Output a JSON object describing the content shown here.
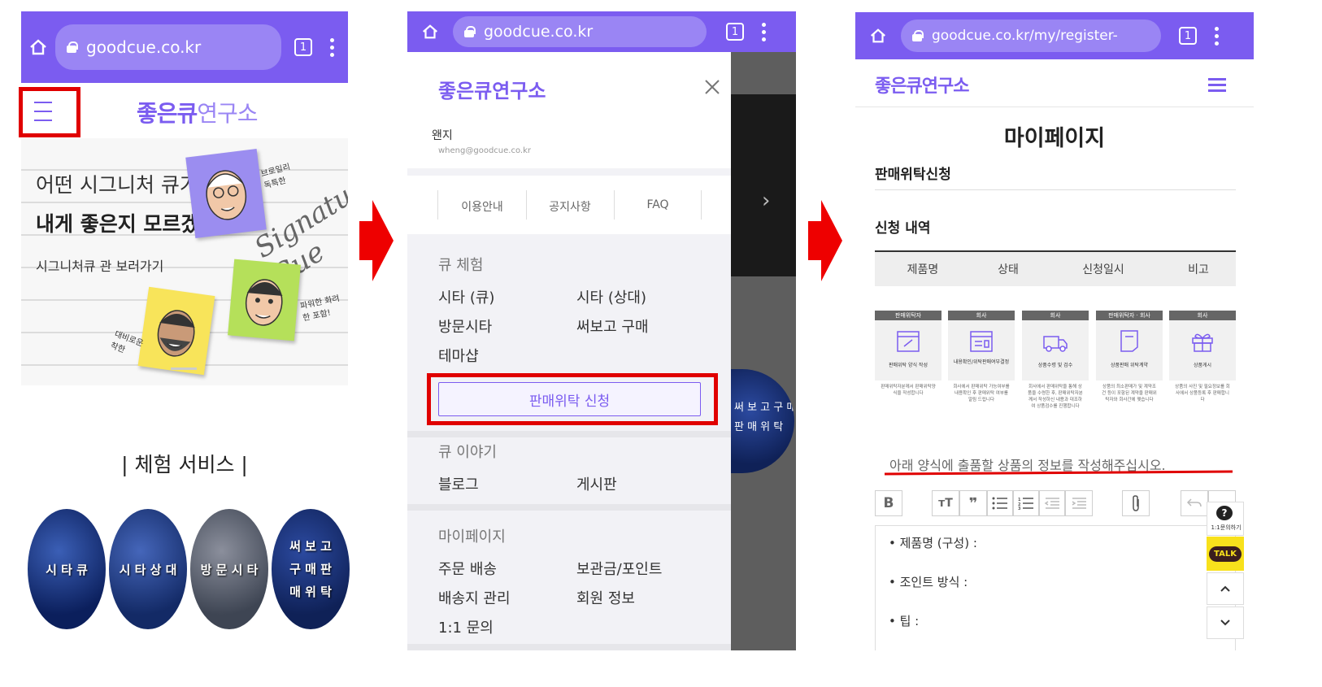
{
  "panel1": {
    "url": "goodcue.co.kr",
    "tab_count": "1",
    "logo_bold": "좋은큐",
    "logo_light": "연구소",
    "banner_line1": "어떤 시그니처 큐가",
    "banner_line2": "내게 좋은지 모르겠다면?",
    "banner_line3": "시그니처큐 관 보러가기",
    "banner_sign": "Signature Cue",
    "banner_note1": "브로일리 독특한",
    "banner_note2": "파워한 화려한 포함!",
    "banner_note3": "대비로운 착한",
    "section_title": "| 체험 서비스 |",
    "circles": [
      "시 타 큐",
      "시 타 상 대",
      "방 문 시 타",
      "써 보 고 구 매 판 매 위 탁"
    ]
  },
  "panel2": {
    "url": "goodcue.co.kr",
    "tab_count": "1",
    "logo": "좋은큐연구소",
    "user_name": "왠지",
    "user_email": "wheng@goodcue.co.kr",
    "quick_tabs": [
      "이용안내",
      "공지사항",
      "FAQ"
    ],
    "section1_title": "큐 체험",
    "section1_items": [
      "시타 (큐)",
      "시타 (상대)",
      "방문시타",
      "써보고 구매",
      "테마샵"
    ],
    "consign_button": "판매위탁 신청",
    "section2_title": "큐 이야기",
    "section2_items": [
      "블로그",
      "게시판"
    ],
    "section3_title": "마이페이지",
    "section3_items": [
      "주문 배송",
      "보관금/포인트",
      "배송지 관리",
      "회원 정보",
      "1:1 문의"
    ],
    "bg_text1": "써 보 고 구 매",
    "bg_text2": "판 매 위 탁"
  },
  "panel3": {
    "url": "goodcue.co.kr/my/register-",
    "tab_count": "1",
    "logo": "좋은큐연구소",
    "page_title": "마이페이지",
    "subtitle": "판매위탁신청",
    "history_title": "신청 내역",
    "table_headers": [
      "제품명",
      "상태",
      "신청일시",
      "비고"
    ],
    "steps": [
      {
        "tag": "판매위탁자",
        "label": "판매위탁 양식 작성",
        "desc": "판매위탁자분께서 판매위탁양식을 작성합니다"
      },
      {
        "tag": "회사",
        "label": "내용확인/위탁판매여부결정",
        "desc": "회사에서 판매위탁 가능여부를 내용확인 후 판매위탁 여부를 알림 드립니다"
      },
      {
        "tag": "회사",
        "label": "상품수령 및 검수",
        "desc": "회사에서 판매위탁을 통해 상품을 수령한 후, 판매위탁자분께서 작성하신 내용과 대조하여 상품검수를 진행합니다"
      },
      {
        "tag": "판매위탁자 · 회사",
        "label": "상품판매 위탁계약",
        "desc": "상품의 최소판매가 및 계약조건 등이 포함된 계약을 판매위탁자와 회사간에 맺습니다"
      },
      {
        "tag": "회사",
        "label": "상품게시",
        "desc": "상품의 사진 및 필요정보를 회사에서 상품등록 후 판매합니다"
      }
    ],
    "instruction": "아래 양식에 출품할 상품의 정보를 작성해주십시오.",
    "form_lines": [
      "• 제품명 (구성) :",
      "• 조인트 방식 :",
      "• 팁 :"
    ],
    "help_label": "1:1문의하기",
    "talk_label": "TALK"
  },
  "colors": {
    "browser_bar": "#7b5cf0",
    "accent": "#7b5cf0",
    "highlight": "#e00000"
  }
}
